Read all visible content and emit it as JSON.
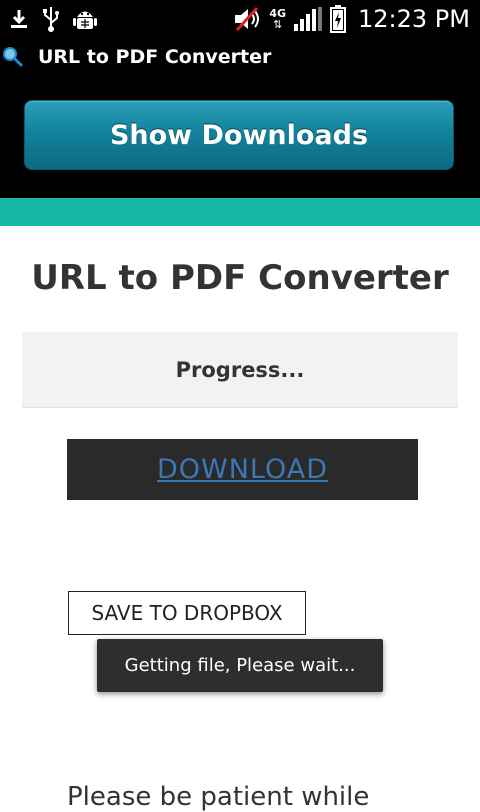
{
  "status_bar": {
    "time": "12:23 PM",
    "network_label": "4G",
    "icons": [
      "download-icon",
      "usb-icon",
      "android-debug-icon",
      "volume-muted-icon",
      "network-4g-icon",
      "signal-icon",
      "battery-charging-icon"
    ]
  },
  "app_bar": {
    "title": "URL to PDF Converter",
    "icon": "search-icon",
    "show_downloads_label": "Show Downloads"
  },
  "main": {
    "page_title": "URL to PDF Converter",
    "progress_text": "Progress...",
    "download_label": "DOWNLOAD",
    "dropbox_label": "SAVE TO DROPBOX",
    "partial_text": "Please be patient while"
  },
  "toast": {
    "message": "Getting file, Please wait..."
  },
  "colors": {
    "teal_band": "#17b8a6",
    "button_teal": "#13839c",
    "link_blue": "#3b78b5",
    "dark_button": "#2a2a2a"
  }
}
